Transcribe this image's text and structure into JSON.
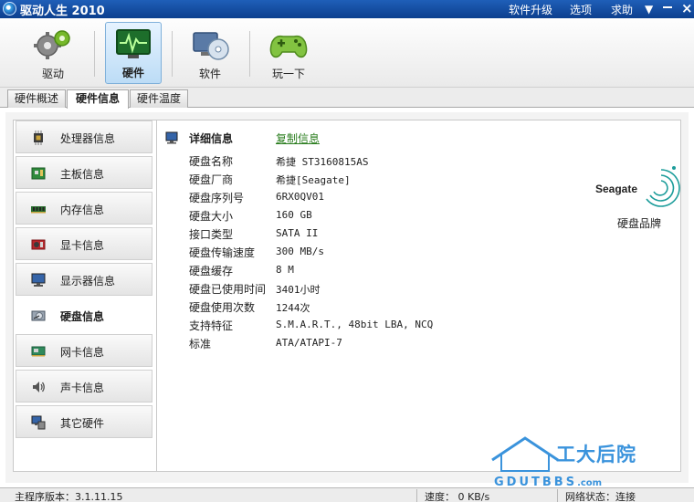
{
  "app": {
    "title": "驱动人生 2010",
    "menu": [
      "软件升级",
      "选项",
      "求助"
    ]
  },
  "toolbar": {
    "items": [
      {
        "label": "驱动",
        "icon": "gears-icon",
        "active": false
      },
      {
        "label": "硬件",
        "icon": "monitor-pulse-icon",
        "active": true
      },
      {
        "label": "软件",
        "icon": "software-disc-icon",
        "active": false
      },
      {
        "label": "玩一下",
        "icon": "gamepad-icon",
        "active": false
      }
    ]
  },
  "subtabs": [
    "硬件概述",
    "硬件信息",
    "硬件温度"
  ],
  "active_subtab": "硬件信息",
  "sidebar": {
    "items": [
      {
        "label": "处理器信息",
        "icon": "cpu-icon"
      },
      {
        "label": "主板信息",
        "icon": "motherboard-icon"
      },
      {
        "label": "内存信息",
        "icon": "memory-icon"
      },
      {
        "label": "显卡信息",
        "icon": "graphics-card-icon"
      },
      {
        "label": "显示器信息",
        "icon": "display-icon"
      },
      {
        "label": "硬盘信息",
        "icon": "hard-disk-icon"
      },
      {
        "label": "网卡信息",
        "icon": "network-card-icon"
      },
      {
        "label": "声卡信息",
        "icon": "speaker-icon"
      },
      {
        "label": "其它硬件",
        "icon": "other-hardware-icon"
      }
    ],
    "active": "硬盘信息"
  },
  "details": {
    "title": "详细信息",
    "copy_link": "复制信息",
    "rows": [
      {
        "label": "硬盘名称",
        "value": "希捷 ST3160815AS"
      },
      {
        "label": "硬盘厂商",
        "value": "希捷[Seagate]"
      },
      {
        "label": "硬盘序列号",
        "value": "6RX0QV01"
      },
      {
        "label": "硬盘大小",
        "value": "160 GB"
      },
      {
        "label": "接口类型",
        "value": "SATA II"
      },
      {
        "label": "硬盘传输速度",
        "value": "300 MB/s"
      },
      {
        "label": "硬盘缓存",
        "value": "8 M"
      },
      {
        "label": "硬盘已使用时间",
        "value": "3401小时"
      },
      {
        "label": "硬盘使用次数",
        "value": "1244次"
      },
      {
        "label": "支持特征",
        "value": "S.M.A.R.T., 48bit LBA, NCQ"
      },
      {
        "label": "标准",
        "value": "ATA/ATAPI-7"
      }
    ],
    "brand": {
      "logo_text": "Seagate",
      "caption": "硬盘品牌"
    }
  },
  "status": {
    "version": "主程序版本：3.1.11.15",
    "speed": "速度： 0 KB/s",
    "network": "网络状态：连接"
  },
  "watermark": {
    "title": "工大后院",
    "sub": "GDUTBBS",
    "suffix": ".com"
  },
  "colors": {
    "title_bar": "#0c3f8e",
    "link": "#2a7d1e",
    "accent": "#3a93dc"
  }
}
